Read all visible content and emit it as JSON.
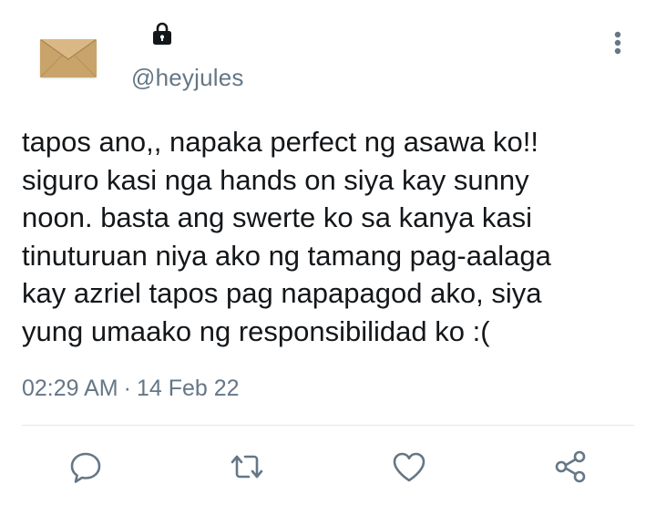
{
  "user": {
    "handle": "@heyjules",
    "avatar_icon": "envelope-avatar",
    "protected_icon": "lock-icon"
  },
  "tweet": {
    "lines": [
      "tapos ano,, napaka perfect ng asawa ko!!",
      "siguro kasi nga hands on siya kay sunny",
      "noon. basta ang swerte ko sa kanya kasi",
      "tinuturuan niya ako ng tamang pag-aalaga",
      "kay azriel tapos pag napapagod ako, siya",
      "yung umaako ng responsibilidad ko :("
    ],
    "time": "02:29 AM",
    "separator": "·",
    "date": "14 Feb 22"
  },
  "icons": {
    "more": "more-vertical-icon",
    "reply": "reply-icon",
    "retweet": "retweet-icon",
    "like": "heart-icon",
    "share": "share-icon"
  },
  "colors": {
    "text": "#14171a",
    "secondary": "#657786",
    "icon": "#657786",
    "divider": "#e1e8ed"
  }
}
